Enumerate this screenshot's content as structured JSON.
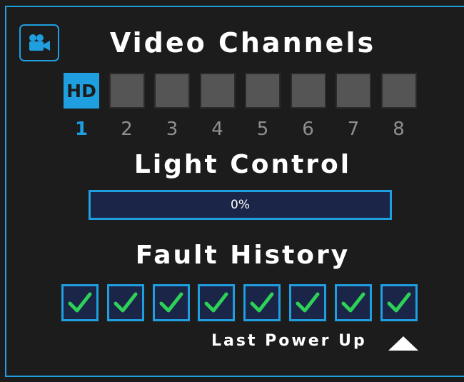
{
  "video": {
    "title": "Video Channels",
    "icon": "video-camera-icon",
    "channels": [
      {
        "number": "1",
        "badge": "HD",
        "active": true
      },
      {
        "number": "2",
        "badge": "",
        "active": false
      },
      {
        "number": "3",
        "badge": "",
        "active": false
      },
      {
        "number": "4",
        "badge": "",
        "active": false
      },
      {
        "number": "5",
        "badge": "",
        "active": false
      },
      {
        "number": "6",
        "badge": "",
        "active": false
      },
      {
        "number": "7",
        "badge": "",
        "active": false
      },
      {
        "number": "8",
        "badge": "",
        "active": false
      }
    ]
  },
  "light": {
    "title": "Light Control",
    "level_percent": 0,
    "level_label": "0%"
  },
  "fault": {
    "title": "Fault History",
    "entries": [
      "ok",
      "ok",
      "ok",
      "ok",
      "ok",
      "ok",
      "ok",
      "ok"
    ],
    "last_power_label": "Last Power Up",
    "check_color": "#2ed158"
  },
  "colors": {
    "accent": "#1f9ee0",
    "background": "#1c1c1c",
    "inactive_channel": "#555555",
    "bar_background": "#1a2547"
  }
}
